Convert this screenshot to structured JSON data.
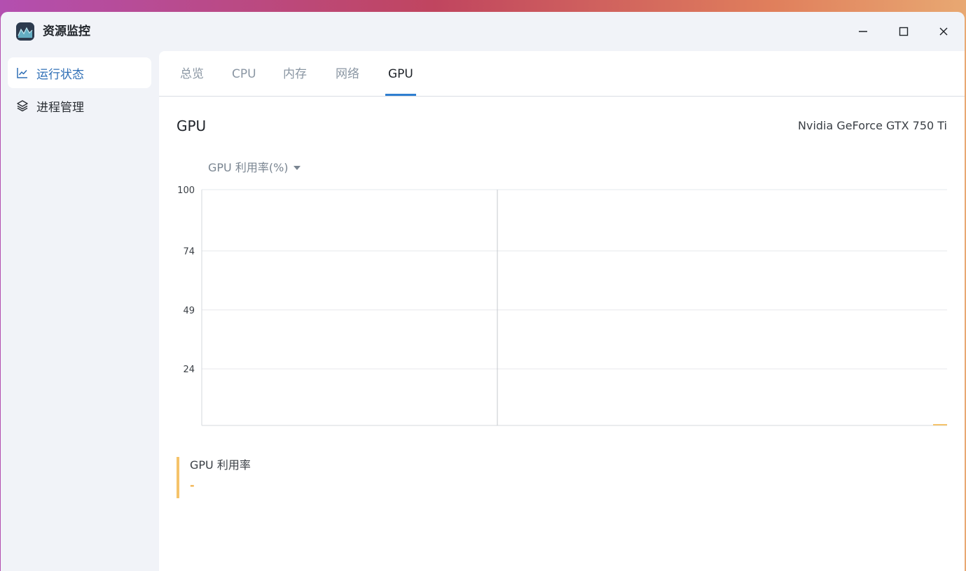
{
  "app": {
    "title": "资源监控",
    "icon": "activity-chart-icon"
  },
  "window_controls": [
    "minimize-icon",
    "maximize-icon",
    "close-icon"
  ],
  "sidebar": {
    "items": [
      {
        "label": "运行状态",
        "icon": "line-chart-icon",
        "active": true
      },
      {
        "label": "进程管理",
        "icon": "layers-icon",
        "active": false
      }
    ]
  },
  "tabs": [
    {
      "label": "总览",
      "active": false
    },
    {
      "label": "CPU",
      "active": false
    },
    {
      "label": "内存",
      "active": false
    },
    {
      "label": "网络",
      "active": false
    },
    {
      "label": "GPU",
      "active": true
    }
  ],
  "main": {
    "title": "GPU",
    "device_name": "Nvidia GeForce GTX 750 Ti",
    "metric_selector": {
      "selected": "GPU 利用率(%)"
    }
  },
  "legend": {
    "name": "GPU 利用率",
    "value": "-",
    "color": "#f5c36a"
  },
  "chart_data": {
    "type": "line",
    "yticks": [
      24,
      49,
      74,
      100
    ],
    "ylim": [
      0,
      100
    ],
    "grid": true,
    "series": [
      {
        "name": "GPU 利用率",
        "color": "#f5c36a",
        "values": [
          0,
          0
        ]
      }
    ]
  }
}
